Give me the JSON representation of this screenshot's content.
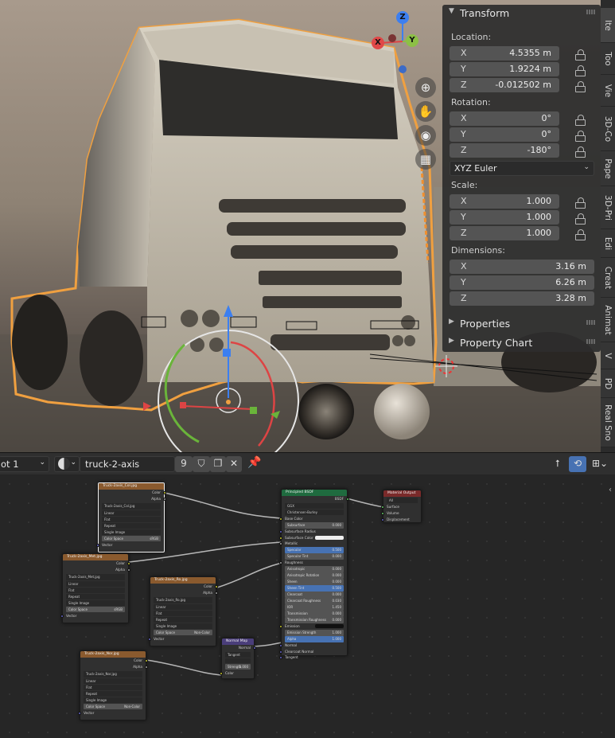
{
  "transform_panel": {
    "title": "Transform",
    "location_label": "Location:",
    "location": [
      {
        "axis": "X",
        "value": "4.5355 m"
      },
      {
        "axis": "Y",
        "value": "1.9224 m"
      },
      {
        "axis": "Z",
        "value": "-0.012502 m"
      }
    ],
    "rotation_label": "Rotation:",
    "rotation": [
      {
        "axis": "X",
        "value": "0°"
      },
      {
        "axis": "Y",
        "value": "0°"
      },
      {
        "axis": "Z",
        "value": "-180°"
      }
    ],
    "rotation_mode": "XYZ Euler",
    "scale_label": "Scale:",
    "scale": [
      {
        "axis": "X",
        "value": "1.000"
      },
      {
        "axis": "Y",
        "value": "1.000"
      },
      {
        "axis": "Z",
        "value": "1.000"
      }
    ],
    "dimensions_label": "Dimensions:",
    "dimensions": [
      {
        "axis": "X",
        "value": "3.16 m"
      },
      {
        "axis": "Y",
        "value": "6.26 m"
      },
      {
        "axis": "Z",
        "value": "3.28 m"
      }
    ],
    "properties_label": "Properties",
    "property_chart_label": "Property Chart"
  },
  "gizmo": {
    "x": "X",
    "y": "Y",
    "z": "Z"
  },
  "sidebar_tabs": [
    "Ite",
    "Too",
    "Vie",
    "3D-Co",
    "Pape",
    "3D-Pri",
    "Edi",
    "Creat",
    "Animat",
    "V",
    "PD",
    "Real Sno"
  ],
  "node_header": {
    "slot": "ot 1",
    "material_name": "truck-2-axis",
    "user_count": "9"
  },
  "nodes": {
    "tex1": {
      "title": "Truck-2axis_Col.jpg",
      "file": "Truck-2axis_Col.jpg"
    },
    "tex2": {
      "title": "Truck-2axis_Met.jpg",
      "file": "Truck-2axis_Met.jpg"
    },
    "tex3": {
      "title": "Truck-2axis_Ro.jpg",
      "file": "Truck-2axis_Ro.jpg"
    },
    "tex4": {
      "title": "Truck-2axis_Nor.jpg",
      "file": "Truck-2axis_Nor.jpg"
    },
    "tex_common": {
      "color": "Color",
      "alpha": "Alpha",
      "interp": "Linear",
      "proj": "Flat",
      "ext": "Repeat",
      "src": "Single Image",
      "colorspace_label": "Color Space",
      "colorspace_srgb": "sRGB",
      "colorspace_non": "Non-Color",
      "vector": "Vector"
    },
    "bsdf": {
      "title": "Principled BSDF",
      "out": "BSDF",
      "dist": "GGX",
      "ss_method": "Christensen-Burley",
      "inputs": [
        {
          "n": "Base Color",
          "v": ""
        },
        {
          "n": "Subsurface",
          "v": "0.000"
        },
        {
          "n": "Subsurface Radius",
          "v": ""
        },
        {
          "n": "Subsurface Color",
          "v": ""
        },
        {
          "n": "Metallic",
          "v": ""
        },
        {
          "n": "Specular",
          "v": "0.500"
        },
        {
          "n": "Specular Tint",
          "v": "0.000"
        },
        {
          "n": "Roughness",
          "v": ""
        },
        {
          "n": "Anisotropic",
          "v": "0.000"
        },
        {
          "n": "Anisotropic Rotation",
          "v": "0.000"
        },
        {
          "n": "Sheen",
          "v": "0.000"
        },
        {
          "n": "Sheen Tint",
          "v": "0.500"
        },
        {
          "n": "Clearcoat",
          "v": "0.000"
        },
        {
          "n": "Clearcoat Roughness",
          "v": "0.030"
        },
        {
          "n": "IOR",
          "v": "1.450"
        },
        {
          "n": "Transmission",
          "v": "0.000"
        },
        {
          "n": "Transmission Roughness",
          "v": "0.000"
        },
        {
          "n": "Emission",
          "v": ""
        },
        {
          "n": "Emission Strength",
          "v": "1.000"
        },
        {
          "n": "Alpha",
          "v": "1.000"
        },
        {
          "n": "Normal",
          "v": ""
        },
        {
          "n": "Clearcoat Normal",
          "v": ""
        },
        {
          "n": "Tangent",
          "v": ""
        }
      ]
    },
    "output": {
      "title": "Material Output",
      "target": "All",
      "surface": "Surface",
      "volume": "Volume",
      "displacement": "Displacement"
    },
    "normalmap": {
      "title": "Normal Map",
      "out": "Normal",
      "space": "Tangent Space",
      "strength_label": "Strength",
      "strength": "1.000",
      "color": "Color"
    }
  }
}
